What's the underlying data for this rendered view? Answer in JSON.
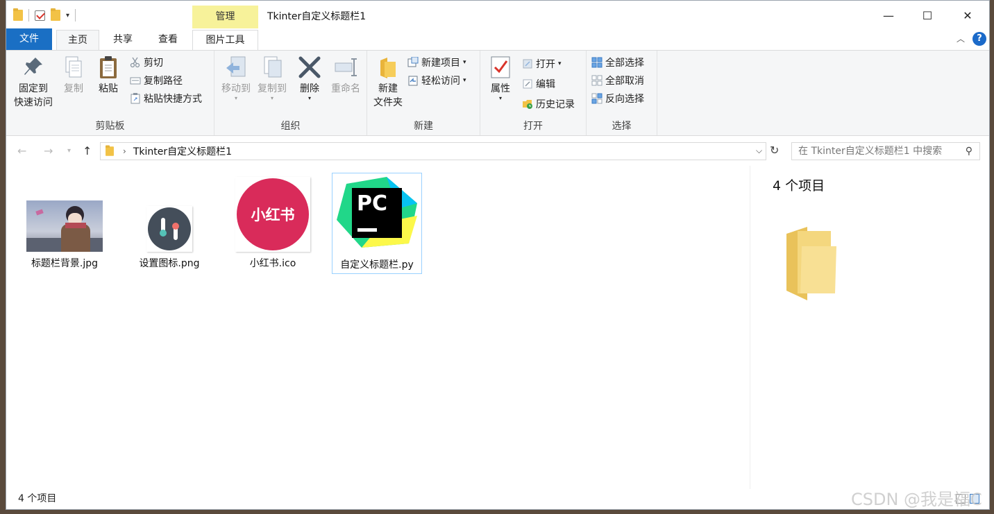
{
  "quick_access": {
    "dropdown_glyph": "▾"
  },
  "context_tab": {
    "label": "管理",
    "color": "#f7f29a"
  },
  "window": {
    "title": "Tkinter自定义标题栏1",
    "min_glyph": "—",
    "max_glyph": "☐",
    "close_glyph": "✕"
  },
  "tabs": {
    "file": "文件",
    "home": "主页",
    "share": "共享",
    "view": "查看",
    "picture_tools": "图片工具",
    "collapse_glyph": "︿",
    "help_glyph": "?"
  },
  "ribbon": {
    "clipboard": {
      "label": "剪贴板",
      "pin_l1": "固定到",
      "pin_l2": "快速访问",
      "copy": "复制",
      "paste": "粘贴",
      "cut": "剪切",
      "copy_path": "复制路径",
      "paste_shortcut": "粘贴快捷方式"
    },
    "organize": {
      "label": "组织",
      "move_to": "移动到",
      "copy_to": "复制到",
      "delete": "删除",
      "rename": "重命名"
    },
    "new": {
      "label": "新建",
      "folder_l1": "新建",
      "folder_l2": "文件夹",
      "new_item": "新建项目",
      "easy_access": "轻松访问"
    },
    "open": {
      "label": "打开",
      "properties": "属性",
      "open": "打开",
      "edit": "编辑",
      "history": "历史记录"
    },
    "select": {
      "label": "选择",
      "select_all": "全部选择",
      "select_none": "全部取消",
      "invert": "反向选择"
    }
  },
  "address": {
    "path": "Tkinter自定义标题栏1",
    "search_placeholder": "在 Tkinter自定义标题栏1 中搜索"
  },
  "files": [
    {
      "name": "标题栏背景.jpg",
      "icon": "image-thumbnail-icon"
    },
    {
      "name": "设置图标.png",
      "icon": "settings-icon"
    },
    {
      "name": "小红书.ico",
      "icon": "xiaohongshu-logo-icon",
      "logo_text": "小红书",
      "color": "#d92b5a"
    },
    {
      "name": "自定义标题栏.py",
      "icon": "pycharm-icon",
      "logo_text": "PC"
    }
  ],
  "preview": {
    "count": "4 个项目"
  },
  "status": {
    "count": "4 个项目"
  },
  "watermark": "CSDN @我是福C"
}
